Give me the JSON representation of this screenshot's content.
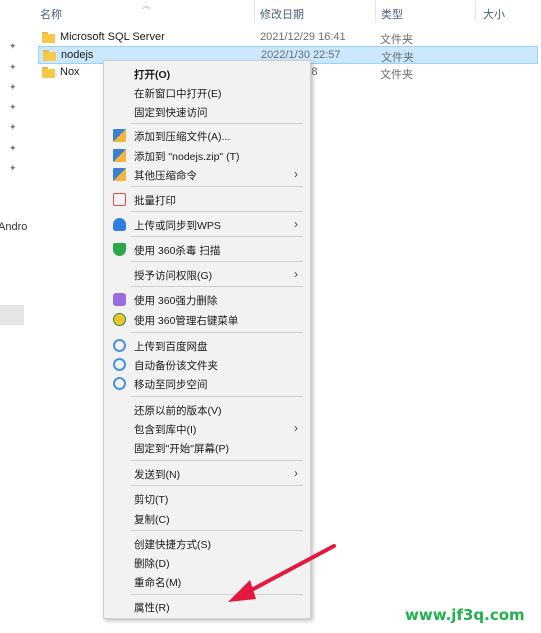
{
  "header": {
    "name": "名称",
    "date_modified": "修改日期",
    "type": "类型",
    "size": "大小"
  },
  "files": [
    {
      "name": "Microsoft SQL Server",
      "date": "2021/12/29 16:41",
      "type": "文件夹"
    },
    {
      "name": "nodejs",
      "date": "2022/1/30 22:57",
      "type": "文件夹"
    },
    {
      "name": "Nox",
      "date": "21:48",
      "type": "文件夹"
    }
  ],
  "nav": {
    "partial_label": "Andro"
  },
  "menu": {
    "open": "打开(O)",
    "open_new_window": "在新窗口中打开(E)",
    "pin_quick": "固定到快速访问",
    "add_archive": "添加到压缩文件(A)...",
    "add_zip": "添加到 \"nodejs.zip\" (T)",
    "other_compress": "其他压缩命令",
    "batch_print": "批量打印",
    "upload_wps": "上传或同步到WPS",
    "scan_360": "使用 360杀毒 扫描",
    "grant_access": "授予访问权限(G)",
    "force_delete_360": "使用 360强力删除",
    "manage_360": "使用 360管理右键菜单",
    "upload_baidu": "上传到百度网盘",
    "auto_backup": "自动备份该文件夹",
    "move_sync": "移动至同步空间",
    "restore": "还原以前的版本(V)",
    "include_library": "包含到库中(I)",
    "pin_start": "固定到\"开始\"屏幕(P)",
    "send_to": "发送到(N)",
    "cut": "剪切(T)",
    "copy": "复制(C)",
    "create_shortcut": "创建快捷方式(S)",
    "delete": "删除(D)",
    "rename": "重命名(M)",
    "properties": "属性(R)"
  },
  "watermark": "www.jf3q.com",
  "colors": {
    "selection": "#cce8ff",
    "menu_bg": "#f2f2f2",
    "arrow": "#e5173f",
    "watermark": "#22b14c"
  }
}
